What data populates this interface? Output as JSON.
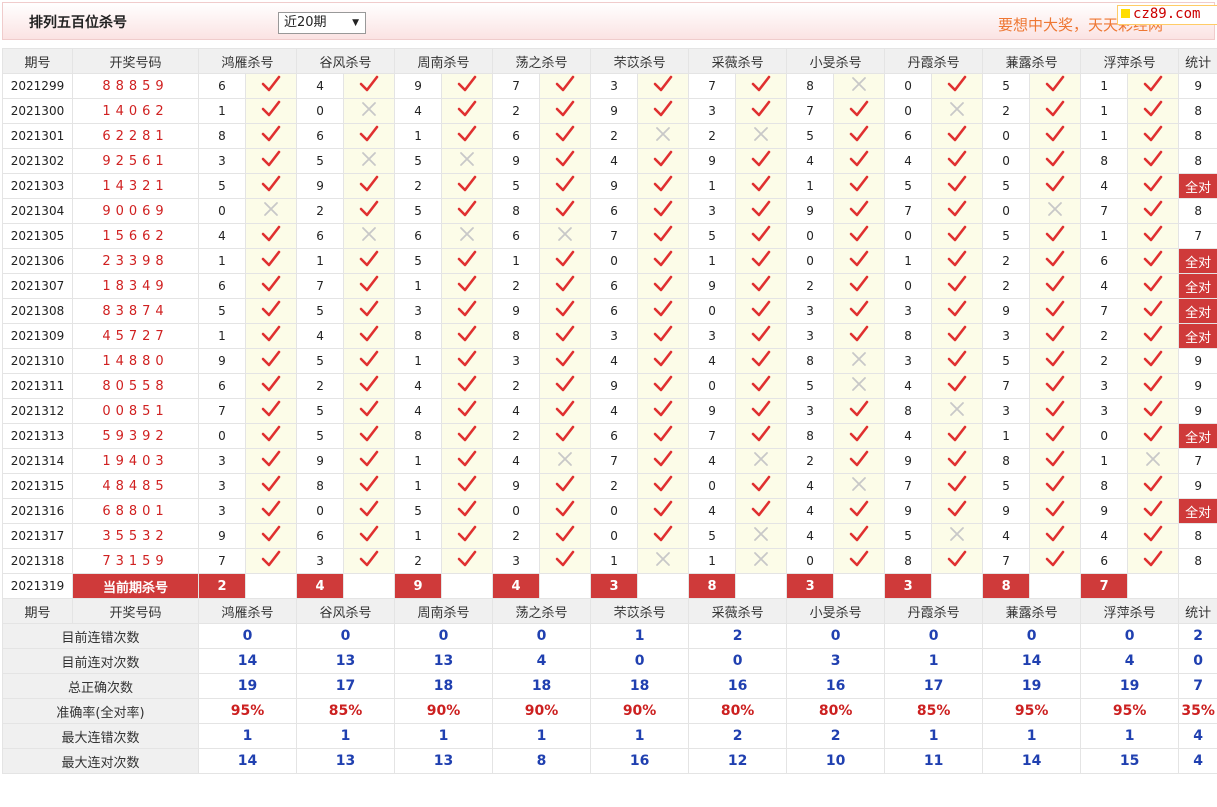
{
  "header": {
    "title": "排列五百位杀号",
    "period_select": "近20期",
    "slogan": "要想中大奖，天天彩经网",
    "logo_text": "cz89.com"
  },
  "columns": {
    "issue": "期号",
    "draw": "开奖号码",
    "experts": [
      "鸿雁杀号",
      "谷风杀号",
      "周南杀号",
      "荡之杀号",
      "芣苡杀号",
      "采薇杀号",
      "小旻杀号",
      "丹霞杀号",
      "蒹露杀号",
      "浮萍杀号"
    ],
    "stat": "统计"
  },
  "marks": {
    "right": "check-icon",
    "wrong": "cross-icon",
    "all_right": "全对"
  },
  "colors": {
    "accent_red": "#cf3a3a",
    "check_red": "#e03030",
    "number_blue": "#2040b0",
    "draw_red": "#d02020"
  },
  "rows": [
    {
      "issue": "2021299",
      "draw": "88859",
      "picks": [
        6,
        4,
        9,
        7,
        3,
        7,
        8,
        0,
        5,
        1
      ],
      "ok": [
        1,
        1,
        1,
        1,
        1,
        1,
        0,
        1,
        1,
        1
      ],
      "stat": "9"
    },
    {
      "issue": "2021300",
      "draw": "14062",
      "picks": [
        1,
        0,
        4,
        2,
        9,
        3,
        7,
        0,
        2,
        1
      ],
      "ok": [
        1,
        0,
        1,
        1,
        1,
        1,
        1,
        0,
        1,
        1
      ],
      "stat": "8"
    },
    {
      "issue": "2021301",
      "draw": "62281",
      "picks": [
        8,
        6,
        1,
        6,
        2,
        2,
        5,
        6,
        0,
        1
      ],
      "ok": [
        1,
        1,
        1,
        1,
        0,
        0,
        1,
        1,
        1,
        1
      ],
      "stat": "8"
    },
    {
      "issue": "2021302",
      "draw": "92561",
      "picks": [
        3,
        5,
        5,
        9,
        4,
        9,
        4,
        4,
        0,
        8
      ],
      "ok": [
        1,
        0,
        0,
        1,
        1,
        1,
        1,
        1,
        1,
        1
      ],
      "stat": "8"
    },
    {
      "issue": "2021303",
      "draw": "14321",
      "picks": [
        5,
        9,
        2,
        5,
        9,
        1,
        1,
        5,
        5,
        4
      ],
      "ok": [
        1,
        1,
        1,
        1,
        1,
        1,
        1,
        1,
        1,
        1
      ],
      "stat": "全对"
    },
    {
      "issue": "2021304",
      "draw": "90069",
      "picks": [
        0,
        2,
        5,
        8,
        6,
        3,
        9,
        7,
        0,
        7
      ],
      "ok": [
        0,
        1,
        1,
        1,
        1,
        1,
        1,
        1,
        0,
        1
      ],
      "stat": "8"
    },
    {
      "issue": "2021305",
      "draw": "15662",
      "picks": [
        4,
        6,
        6,
        6,
        7,
        5,
        0,
        0,
        5,
        1
      ],
      "ok": [
        1,
        0,
        0,
        0,
        1,
        1,
        1,
        1,
        1,
        1
      ],
      "stat": "7"
    },
    {
      "issue": "2021306",
      "draw": "23398",
      "picks": [
        1,
        1,
        5,
        1,
        0,
        1,
        0,
        1,
        2,
        6
      ],
      "ok": [
        1,
        1,
        1,
        1,
        1,
        1,
        1,
        1,
        1,
        1
      ],
      "stat": "全对"
    },
    {
      "issue": "2021307",
      "draw": "18349",
      "picks": [
        6,
        7,
        1,
        2,
        6,
        9,
        2,
        0,
        2,
        4
      ],
      "ok": [
        1,
        1,
        1,
        1,
        1,
        1,
        1,
        1,
        1,
        1
      ],
      "stat": "全对"
    },
    {
      "issue": "2021308",
      "draw": "83874",
      "picks": [
        5,
        5,
        3,
        9,
        6,
        0,
        3,
        3,
        9,
        7
      ],
      "ok": [
        1,
        1,
        1,
        1,
        1,
        1,
        1,
        1,
        1,
        1
      ],
      "stat": "全对"
    },
    {
      "issue": "2021309",
      "draw": "45727",
      "picks": [
        1,
        4,
        8,
        8,
        3,
        3,
        3,
        8,
        3,
        2
      ],
      "ok": [
        1,
        1,
        1,
        1,
        1,
        1,
        1,
        1,
        1,
        1
      ],
      "stat": "全对"
    },
    {
      "issue": "2021310",
      "draw": "14880",
      "picks": [
        9,
        5,
        1,
        3,
        4,
        4,
        8,
        3,
        5,
        2
      ],
      "ok": [
        1,
        1,
        1,
        1,
        1,
        1,
        0,
        1,
        1,
        1
      ],
      "stat": "9"
    },
    {
      "issue": "2021311",
      "draw": "80558",
      "picks": [
        6,
        2,
        4,
        2,
        9,
        0,
        5,
        4,
        7,
        3
      ],
      "ok": [
        1,
        1,
        1,
        1,
        1,
        1,
        0,
        1,
        1,
        1
      ],
      "stat": "9"
    },
    {
      "issue": "2021312",
      "draw": "00851",
      "picks": [
        7,
        5,
        4,
        4,
        4,
        9,
        3,
        8,
        3,
        3
      ],
      "ok": [
        1,
        1,
        1,
        1,
        1,
        1,
        1,
        0,
        1,
        1
      ],
      "stat": "9"
    },
    {
      "issue": "2021313",
      "draw": "59392",
      "picks": [
        0,
        5,
        8,
        2,
        6,
        7,
        8,
        4,
        1,
        0
      ],
      "ok": [
        1,
        1,
        1,
        1,
        1,
        1,
        1,
        1,
        1,
        1
      ],
      "stat": "全对"
    },
    {
      "issue": "2021314",
      "draw": "19403",
      "picks": [
        3,
        9,
        1,
        4,
        7,
        4,
        2,
        9,
        8,
        1
      ],
      "ok": [
        1,
        1,
        1,
        0,
        1,
        0,
        1,
        1,
        1,
        0
      ],
      "stat": "7"
    },
    {
      "issue": "2021315",
      "draw": "48485",
      "picks": [
        3,
        8,
        1,
        9,
        2,
        0,
        4,
        7,
        5,
        8
      ],
      "ok": [
        1,
        1,
        1,
        1,
        1,
        1,
        0,
        1,
        1,
        1
      ],
      "stat": "9"
    },
    {
      "issue": "2021316",
      "draw": "68801",
      "picks": [
        3,
        0,
        5,
        0,
        0,
        4,
        4,
        9,
        9,
        9
      ],
      "ok": [
        1,
        1,
        1,
        1,
        1,
        1,
        1,
        1,
        1,
        1
      ],
      "stat": "全对"
    },
    {
      "issue": "2021317",
      "draw": "35532",
      "picks": [
        9,
        6,
        1,
        2,
        0,
        5,
        4,
        5,
        4,
        4
      ],
      "ok": [
        1,
        1,
        1,
        1,
        1,
        0,
        1,
        0,
        1,
        1
      ],
      "stat": "8"
    },
    {
      "issue": "2021318",
      "draw": "73159",
      "picks": [
        7,
        3,
        2,
        3,
        1,
        1,
        0,
        8,
        7,
        6
      ],
      "ok": [
        1,
        1,
        1,
        1,
        0,
        0,
        1,
        1,
        1,
        1
      ],
      "stat": "8"
    }
  ],
  "current": {
    "issue": "2021319",
    "label": "当前期杀号",
    "picks": [
      "2",
      "4",
      "9",
      "4",
      "3",
      "8",
      "3",
      "3",
      "8",
      "7"
    ]
  },
  "stats": [
    {
      "label": "目前连错次数",
      "values": [
        "0",
        "0",
        "0",
        "0",
        "1",
        "2",
        "0",
        "0",
        "0",
        "0"
      ],
      "total": "2"
    },
    {
      "label": "目前连对次数",
      "values": [
        "14",
        "13",
        "13",
        "4",
        "0",
        "0",
        "3",
        "1",
        "14",
        "4"
      ],
      "total": "0"
    },
    {
      "label": "总正确次数",
      "values": [
        "19",
        "17",
        "18",
        "18",
        "18",
        "16",
        "16",
        "17",
        "19",
        "19"
      ],
      "total": "7"
    },
    {
      "label": "准确率(全对率)",
      "values": [
        "95%",
        "85%",
        "90%",
        "90%",
        "90%",
        "80%",
        "80%",
        "85%",
        "95%",
        "95%"
      ],
      "total": "35%",
      "rate": true
    },
    {
      "label": "最大连错次数",
      "values": [
        "1",
        "1",
        "1",
        "1",
        "1",
        "2",
        "2",
        "1",
        "1",
        "1"
      ],
      "total": "4"
    },
    {
      "label": "最大连对次数",
      "values": [
        "14",
        "13",
        "13",
        "8",
        "16",
        "12",
        "10",
        "11",
        "14",
        "15"
      ],
      "total": "4"
    }
  ]
}
